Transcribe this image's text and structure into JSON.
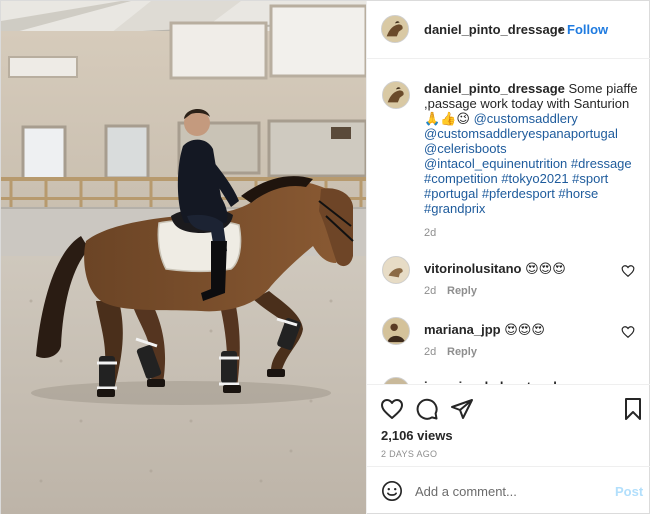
{
  "header": {
    "username": "daniel_pinto_dressage",
    "separator": "•",
    "follow_label": "Follow"
  },
  "caption": {
    "username": "daniel_pinto_dressage",
    "text_lines": [
      "Some piaffe",
      ",passage work today with Santurion",
      "🙏👍😉"
    ],
    "mention_1": "@customsaddlery",
    "mention_2": "@customsaddleryespanaportugal",
    "mention_3": "@celerisboots",
    "mention_4": "@intacol_equinenutrition",
    "hashtags_line1": "#dressage",
    "hashtags_line2": "#competition #tokyo2021 #sport",
    "hashtags_line3": "#portugal #pferdesport #horse",
    "hashtags_line4": "#grandprix",
    "time": "2d"
  },
  "comments": [
    {
      "username": "vitorinolusitano",
      "text": "😍😍😍",
      "time": "2d",
      "reply_label": "Reply"
    },
    {
      "username": "mariana_jpp",
      "text": "😍😍😍",
      "time": "2d",
      "reply_label": "Reply"
    },
    {
      "username": "joaquinsaladosotenche",
      "text": "",
      "time": "",
      "reply_label": ""
    }
  ],
  "actions": {
    "icons": [
      "heart-icon",
      "comment-icon",
      "share-icon",
      "bookmark-icon"
    ],
    "views": "2,106 views",
    "date": "2 DAYS AGO"
  },
  "add_comment": {
    "placeholder": "Add a comment...",
    "post_label": "Post"
  },
  "colors": {
    "link": "#1e5b9c",
    "follow": "#1f7be0",
    "post_disabled": "#b2dffc",
    "muted": "#8e8e8e"
  }
}
